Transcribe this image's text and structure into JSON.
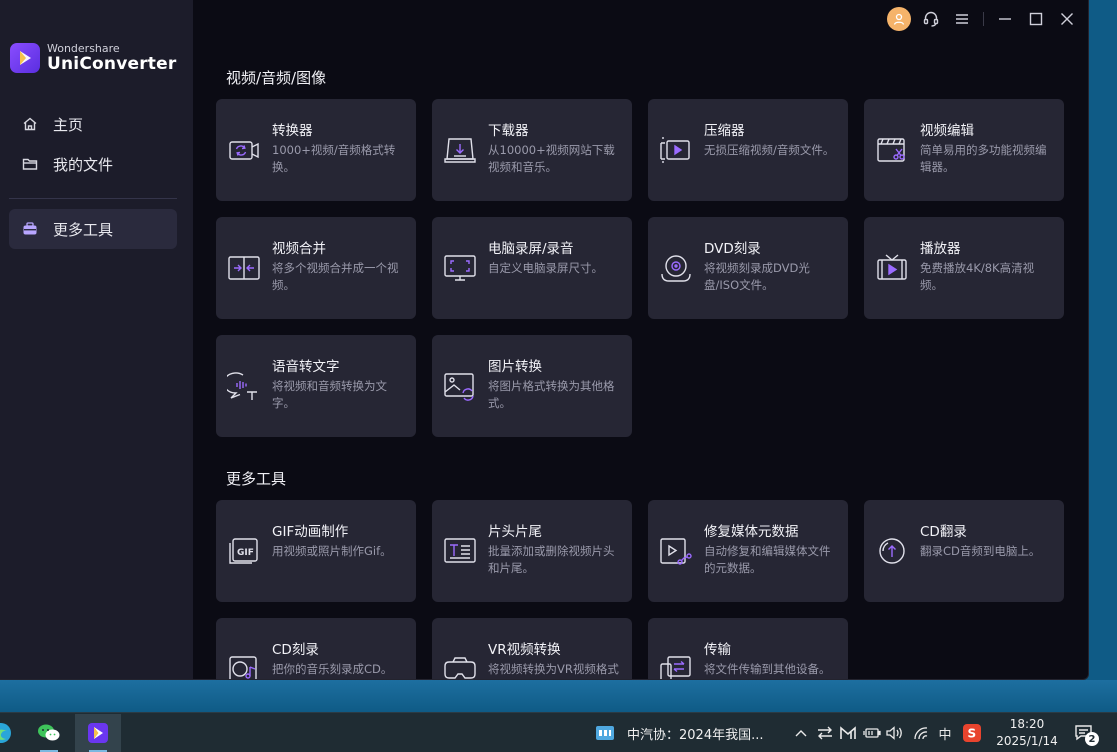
{
  "app": {
    "brand": "Wondershare",
    "product": "UniConverter",
    "accent": "#8a4dff"
  },
  "sidebar": {
    "items": [
      {
        "label": "主页",
        "icon": "home-icon"
      },
      {
        "label": "我的文件",
        "icon": "folder-icon"
      },
      {
        "label": "更多工具",
        "icon": "toolbox-icon",
        "active": true
      }
    ]
  },
  "sections": [
    {
      "title": "视频/音频/图像",
      "cards": [
        {
          "title": "转换器",
          "desc": "1000+视频/音频格式转换。",
          "icon": "converter-icon"
        },
        {
          "title": "下载器",
          "desc": "从10000+视频网站下载视频和音乐。",
          "icon": "downloader-icon"
        },
        {
          "title": "压缩器",
          "desc": "无损压缩视频/音频文件。",
          "icon": "compressor-icon"
        },
        {
          "title": "视频编辑",
          "desc": "简单易用的多功能视频编辑器。",
          "icon": "video-editor-icon"
        },
        {
          "title": "视频合并",
          "desc": "将多个视频合并成一个视频。",
          "icon": "merger-icon"
        },
        {
          "title": "电脑录屏/录音",
          "desc": "自定义电脑录屏尺寸。",
          "icon": "screen-recorder-icon"
        },
        {
          "title": "DVD刻录",
          "desc": "将视频刻录成DVD光盘/ISO文件。",
          "icon": "dvd-burner-icon"
        },
        {
          "title": "播放器",
          "desc": "免费播放4K/8K高清视频。",
          "icon": "player-icon"
        },
        {
          "title": "语音转文字",
          "desc": "将视频和音频转换为文字。",
          "icon": "speech-to-text-icon"
        },
        {
          "title": "图片转换",
          "desc": "将图片格式转换为其他格式。",
          "icon": "image-converter-icon"
        }
      ]
    },
    {
      "title": "更多工具",
      "cards": [
        {
          "title": "GIF动画制作",
          "desc": "用视频或照片制作Gif。",
          "icon": "gif-maker-icon"
        },
        {
          "title": "片头片尾",
          "desc": "批量添加或删除视频片头和片尾。",
          "icon": "intro-outro-icon"
        },
        {
          "title": "修复媒体元数据",
          "desc": "自动修复和编辑媒体文件的元数据。",
          "icon": "metadata-icon"
        },
        {
          "title": "CD翻录",
          "desc": "翻录CD音频到电脑上。",
          "icon": "cd-ripper-icon"
        },
        {
          "title": "CD刻录",
          "desc": "把你的音乐刻录成CD。",
          "icon": "cd-burner-icon"
        },
        {
          "title": "VR视频转换",
          "desc": "将视频转换为VR视频格式",
          "icon": "vr-converter-icon"
        },
        {
          "title": "传输",
          "desc": "将文件传输到其他设备。",
          "icon": "transfer-icon"
        }
      ]
    }
  ],
  "taskbar": {
    "news": "中汽协：2024年我国...",
    "ime": "中",
    "time": "18:20",
    "date": "2025/1/14",
    "notifications": "2"
  }
}
